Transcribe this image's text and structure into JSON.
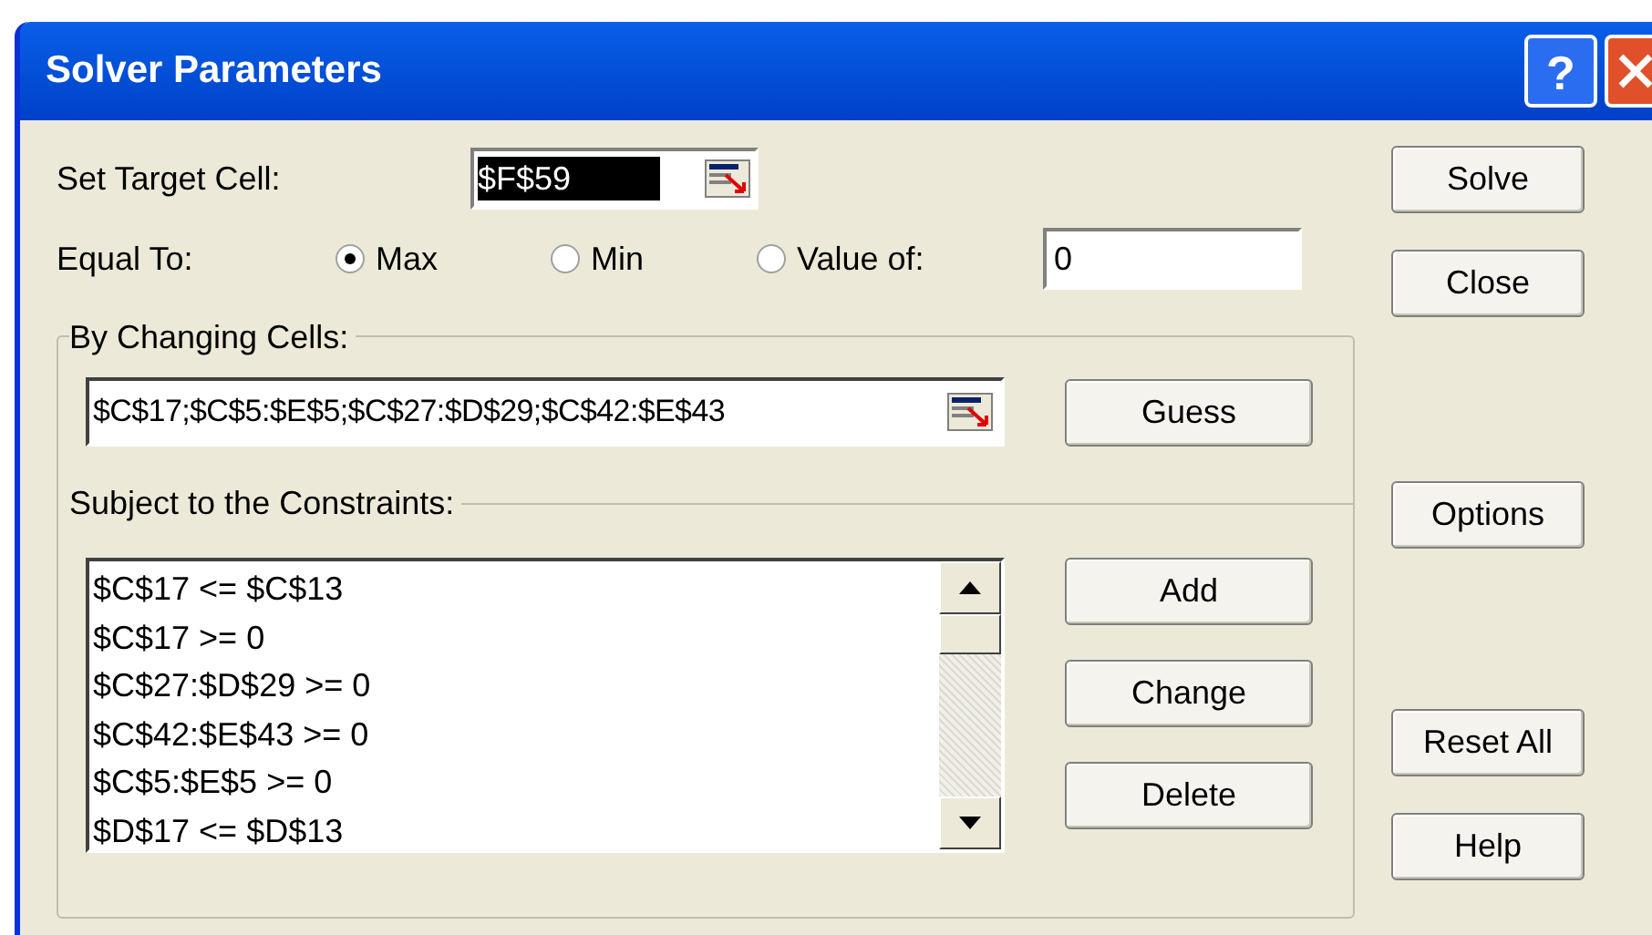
{
  "window": {
    "title": "Solver Parameters"
  },
  "title_buttons": [
    {
      "kind": "help",
      "label": "?"
    },
    {
      "kind": "close"
    }
  ],
  "target_cell": {
    "label": "Set Target Cell:",
    "value": "$F$59",
    "highlighted": true
  },
  "equal_to": {
    "label": "Equal To:",
    "options": [
      {
        "label": "Max",
        "selected": true
      },
      {
        "label": "Min",
        "selected": false
      },
      {
        "label": "Value of:",
        "selected": false
      }
    ],
    "value": "0"
  },
  "changing_cells": {
    "label": "By Changing Cells:",
    "value": "$C$17;$C$5:$E$5;$C$27:$D$29;$C$42:$E$43",
    "button": "Guess"
  },
  "constraints": {
    "label": "Subject to the Constraints:",
    "items": [
      "$C$17 <= $C$13",
      "$C$17 >= 0",
      "$C$27:$D$29 >= 0",
      "$C$42:$E$43 >= 0",
      "$C$5:$E$5 >= 0",
      "$D$17 <= $D$13"
    ],
    "buttons": [
      "Add",
      "Change",
      "Delete"
    ]
  },
  "buttons_top": [
    "Solve",
    "Close"
  ],
  "buttons_middle": [
    "Options"
  ],
  "buttons_bottom": [
    "Reset All",
    "Help"
  ]
}
